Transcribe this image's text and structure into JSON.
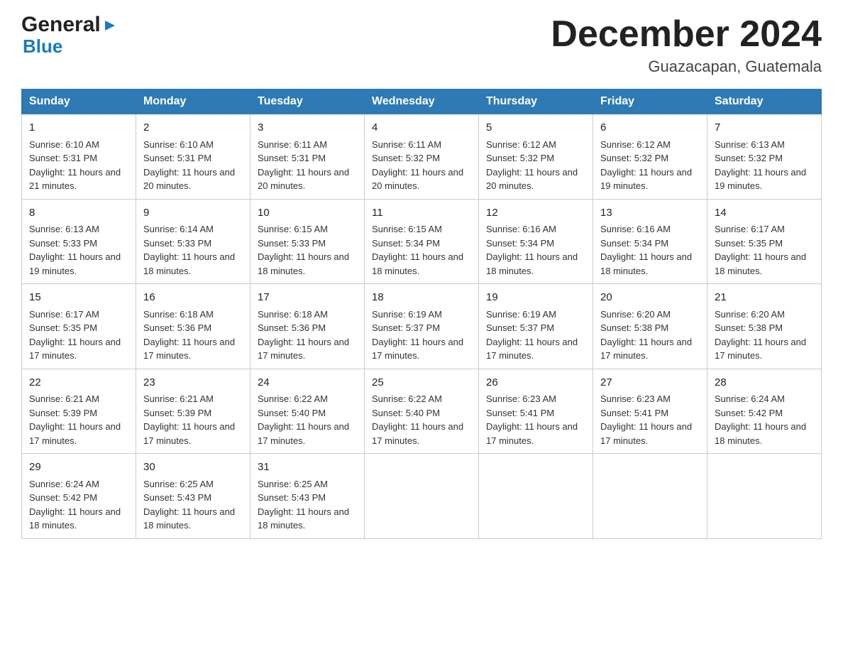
{
  "logo": {
    "general": "General",
    "blue": "Blue",
    "triangle": "▶"
  },
  "title": "December 2024",
  "location": "Guazacapan, Guatemala",
  "days_of_week": [
    "Sunday",
    "Monday",
    "Tuesday",
    "Wednesday",
    "Thursday",
    "Friday",
    "Saturday"
  ],
  "weeks": [
    [
      {
        "day": 1,
        "sunrise": "6:10 AM",
        "sunset": "5:31 PM",
        "daylight": "11 hours and 21 minutes."
      },
      {
        "day": 2,
        "sunrise": "6:10 AM",
        "sunset": "5:31 PM",
        "daylight": "11 hours and 20 minutes."
      },
      {
        "day": 3,
        "sunrise": "6:11 AM",
        "sunset": "5:31 PM",
        "daylight": "11 hours and 20 minutes."
      },
      {
        "day": 4,
        "sunrise": "6:11 AM",
        "sunset": "5:32 PM",
        "daylight": "11 hours and 20 minutes."
      },
      {
        "day": 5,
        "sunrise": "6:12 AM",
        "sunset": "5:32 PM",
        "daylight": "11 hours and 20 minutes."
      },
      {
        "day": 6,
        "sunrise": "6:12 AM",
        "sunset": "5:32 PM",
        "daylight": "11 hours and 19 minutes."
      },
      {
        "day": 7,
        "sunrise": "6:13 AM",
        "sunset": "5:32 PM",
        "daylight": "11 hours and 19 minutes."
      }
    ],
    [
      {
        "day": 8,
        "sunrise": "6:13 AM",
        "sunset": "5:33 PM",
        "daylight": "11 hours and 19 minutes."
      },
      {
        "day": 9,
        "sunrise": "6:14 AM",
        "sunset": "5:33 PM",
        "daylight": "11 hours and 18 minutes."
      },
      {
        "day": 10,
        "sunrise": "6:15 AM",
        "sunset": "5:33 PM",
        "daylight": "11 hours and 18 minutes."
      },
      {
        "day": 11,
        "sunrise": "6:15 AM",
        "sunset": "5:34 PM",
        "daylight": "11 hours and 18 minutes."
      },
      {
        "day": 12,
        "sunrise": "6:16 AM",
        "sunset": "5:34 PM",
        "daylight": "11 hours and 18 minutes."
      },
      {
        "day": 13,
        "sunrise": "6:16 AM",
        "sunset": "5:34 PM",
        "daylight": "11 hours and 18 minutes."
      },
      {
        "day": 14,
        "sunrise": "6:17 AM",
        "sunset": "5:35 PM",
        "daylight": "11 hours and 18 minutes."
      }
    ],
    [
      {
        "day": 15,
        "sunrise": "6:17 AM",
        "sunset": "5:35 PM",
        "daylight": "11 hours and 17 minutes."
      },
      {
        "day": 16,
        "sunrise": "6:18 AM",
        "sunset": "5:36 PM",
        "daylight": "11 hours and 17 minutes."
      },
      {
        "day": 17,
        "sunrise": "6:18 AM",
        "sunset": "5:36 PM",
        "daylight": "11 hours and 17 minutes."
      },
      {
        "day": 18,
        "sunrise": "6:19 AM",
        "sunset": "5:37 PM",
        "daylight": "11 hours and 17 minutes."
      },
      {
        "day": 19,
        "sunrise": "6:19 AM",
        "sunset": "5:37 PM",
        "daylight": "11 hours and 17 minutes."
      },
      {
        "day": 20,
        "sunrise": "6:20 AM",
        "sunset": "5:38 PM",
        "daylight": "11 hours and 17 minutes."
      },
      {
        "day": 21,
        "sunrise": "6:20 AM",
        "sunset": "5:38 PM",
        "daylight": "11 hours and 17 minutes."
      }
    ],
    [
      {
        "day": 22,
        "sunrise": "6:21 AM",
        "sunset": "5:39 PM",
        "daylight": "11 hours and 17 minutes."
      },
      {
        "day": 23,
        "sunrise": "6:21 AM",
        "sunset": "5:39 PM",
        "daylight": "11 hours and 17 minutes."
      },
      {
        "day": 24,
        "sunrise": "6:22 AM",
        "sunset": "5:40 PM",
        "daylight": "11 hours and 17 minutes."
      },
      {
        "day": 25,
        "sunrise": "6:22 AM",
        "sunset": "5:40 PM",
        "daylight": "11 hours and 17 minutes."
      },
      {
        "day": 26,
        "sunrise": "6:23 AM",
        "sunset": "5:41 PM",
        "daylight": "11 hours and 17 minutes."
      },
      {
        "day": 27,
        "sunrise": "6:23 AM",
        "sunset": "5:41 PM",
        "daylight": "11 hours and 17 minutes."
      },
      {
        "day": 28,
        "sunrise": "6:24 AM",
        "sunset": "5:42 PM",
        "daylight": "11 hours and 18 minutes."
      }
    ],
    [
      {
        "day": 29,
        "sunrise": "6:24 AM",
        "sunset": "5:42 PM",
        "daylight": "11 hours and 18 minutes."
      },
      {
        "day": 30,
        "sunrise": "6:25 AM",
        "sunset": "5:43 PM",
        "daylight": "11 hours and 18 minutes."
      },
      {
        "day": 31,
        "sunrise": "6:25 AM",
        "sunset": "5:43 PM",
        "daylight": "11 hours and 18 minutes."
      },
      null,
      null,
      null,
      null
    ]
  ],
  "labels": {
    "sunrise": "Sunrise:",
    "sunset": "Sunset:",
    "daylight": "Daylight:"
  }
}
